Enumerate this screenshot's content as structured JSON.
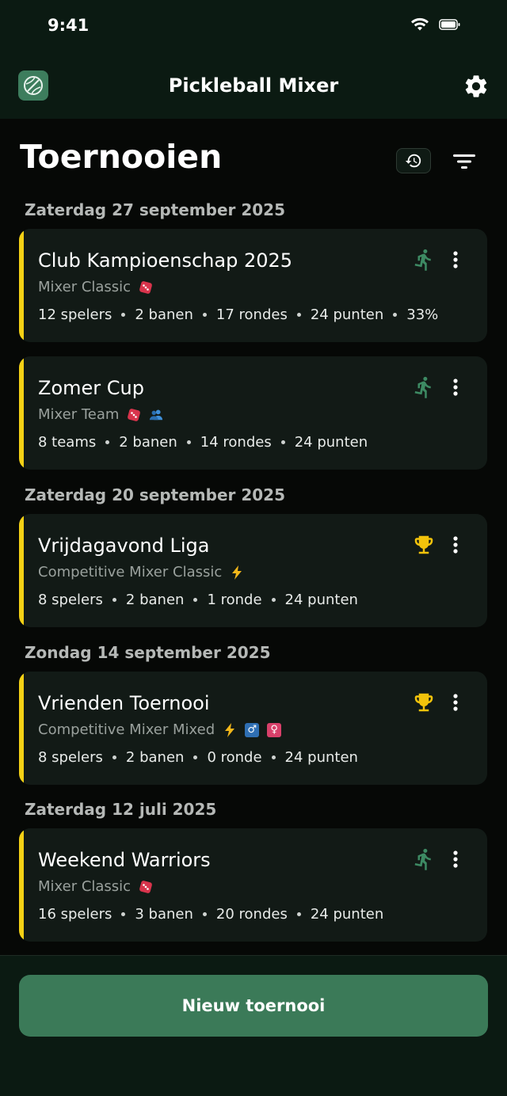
{
  "status_bar": {
    "time": "9:41"
  },
  "app": {
    "title": "Pickleball Mixer"
  },
  "page": {
    "title": "Toernooien"
  },
  "sections": [
    {
      "date": "Zaterdag 27 september 2025"
    },
    {
      "date": "Zaterdag 20 september 2025"
    },
    {
      "date": "Zondag 14 september 2025"
    },
    {
      "date": "Zaterdag 12 juli 2025"
    }
  ],
  "tournaments": [
    {
      "name": "Club Kampioenschap 2025",
      "format": "Mixer Classic",
      "status": "running",
      "meta": [
        "12 spelers",
        "2 banen",
        "17 rondes",
        "24 punten",
        "33%"
      ]
    },
    {
      "name": "Zomer Cup",
      "format": "Mixer Team",
      "status": "running",
      "meta": [
        "8 teams",
        "2 banen",
        "14 rondes",
        "24 punten"
      ]
    },
    {
      "name": "Vrijdagavond Liga",
      "format": "Competitive Mixer Classic",
      "status": "finished",
      "meta": [
        "8 spelers",
        "2 banen",
        "1 ronde",
        "24 punten"
      ]
    },
    {
      "name": "Vrienden Toernooi",
      "format": "Competitive Mixer Mixed",
      "status": "finished",
      "meta": [
        "8 spelers",
        "2 banen",
        "0 ronde",
        "24 punten"
      ]
    },
    {
      "name": "Weekend Warriors",
      "format": "Mixer Classic",
      "status": "running",
      "meta": [
        "16 spelers",
        "3 banen",
        "20 rondes",
        "24 punten"
      ]
    }
  ],
  "new_tournament_button": "Nieuw toernooi",
  "colors": {
    "accent": "#3b7a58",
    "card_stripe": "#f3d015",
    "running_icon": "#3d8a63",
    "trophy": "#f3c30b"
  }
}
